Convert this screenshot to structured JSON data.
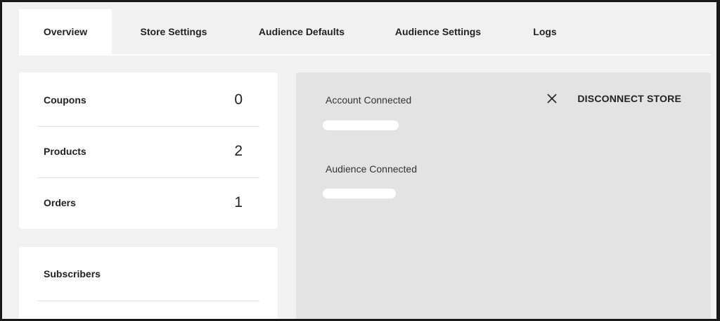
{
  "tabs": [
    {
      "label": "Overview",
      "active": true
    },
    {
      "label": "Store Settings",
      "active": false
    },
    {
      "label": "Audience Defaults",
      "active": false
    },
    {
      "label": "Audience Settings",
      "active": false
    },
    {
      "label": "Logs",
      "active": false
    }
  ],
  "stats": [
    {
      "label": "Coupons",
      "value": "0"
    },
    {
      "label": "Products",
      "value": "2"
    },
    {
      "label": "Orders",
      "value": "1"
    }
  ],
  "subscribers": {
    "label": "Subscribers"
  },
  "connection": {
    "account_label": "Account Connected",
    "audience_label": "Audience Connected",
    "disconnect_label": "DISCONNECT STORE"
  },
  "icons": {
    "close": "close-icon"
  },
  "colors": {
    "panel_bg": "#e3e3e3",
    "page_bg": "#f1f1f1",
    "card_bg": "#ffffff"
  }
}
